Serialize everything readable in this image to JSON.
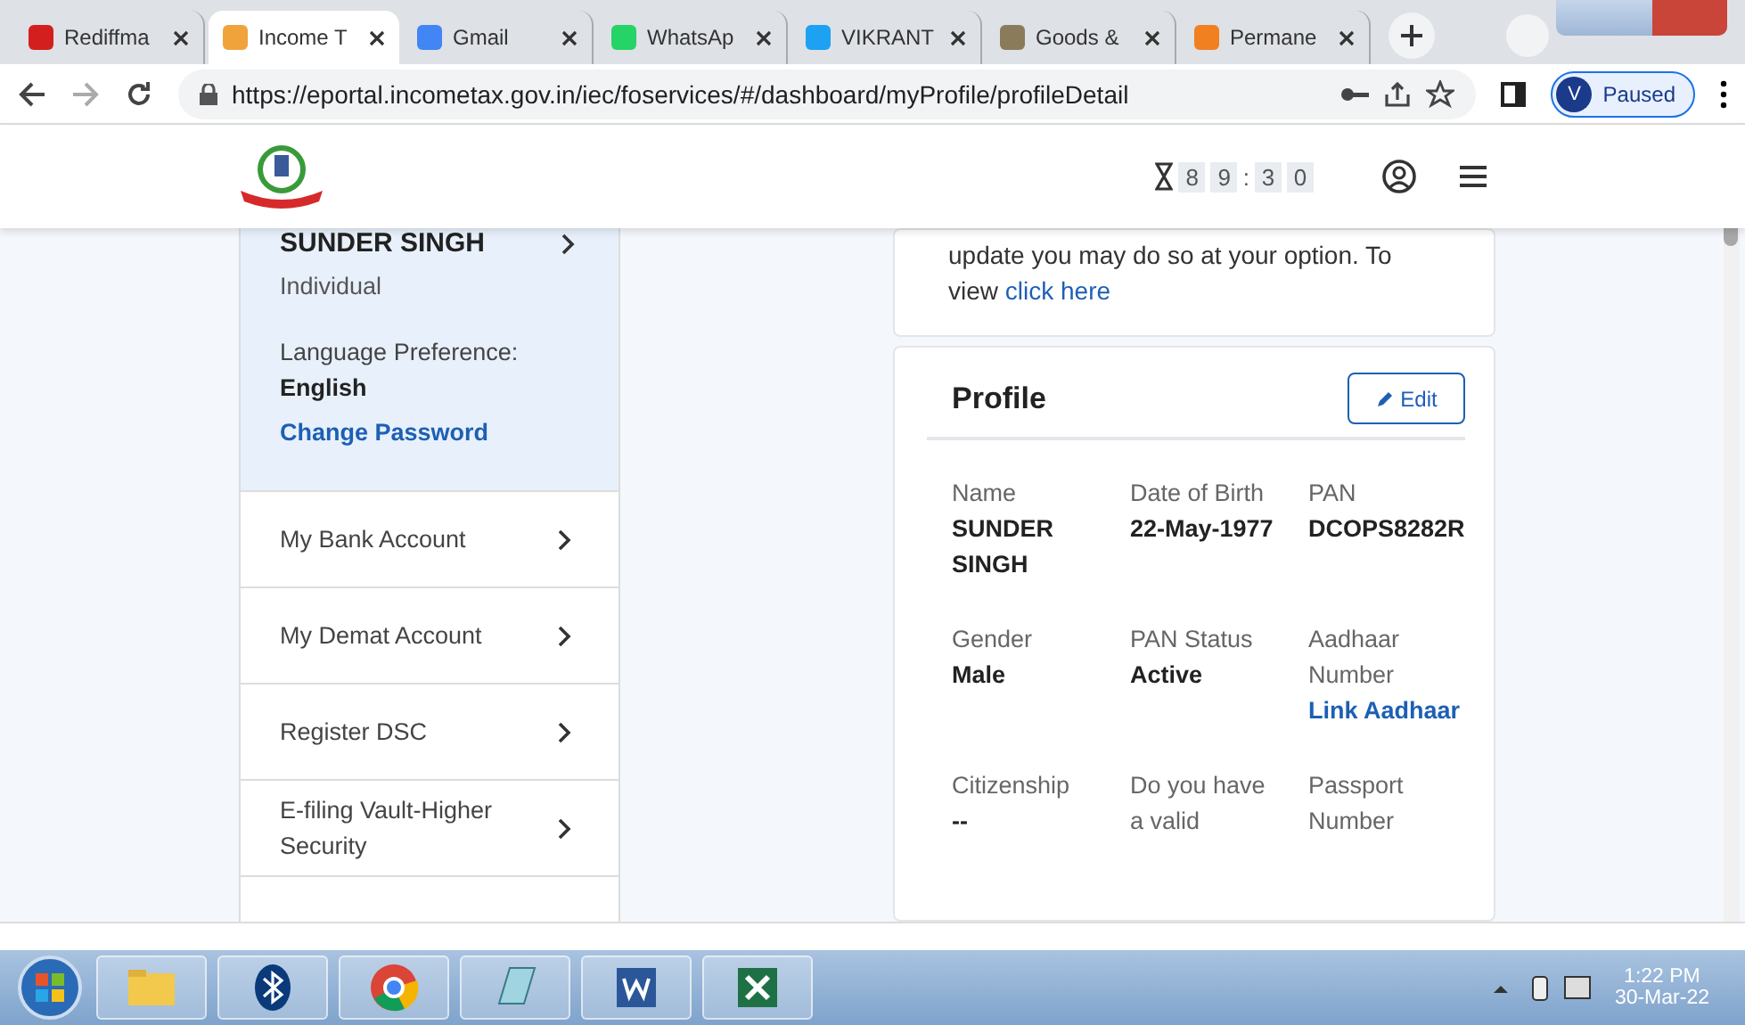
{
  "browser": {
    "tabs": [
      {
        "title": "Rediffma",
        "selected": false
      },
      {
        "title": "Income T",
        "selected": true
      },
      {
        "title": "Gmail",
        "selected": false
      },
      {
        "title": "WhatsAp",
        "selected": false
      },
      {
        "title": "VIKRANT",
        "selected": false
      },
      {
        "title": "Goods &",
        "selected": false
      },
      {
        "title": "Permane",
        "selected": false
      }
    ],
    "url": "https://eportal.incometax.gov.in/iec/foservices/#/dashboard/myProfile/profileDetail",
    "profile_initial": "V",
    "profile_status": "Paused"
  },
  "header": {
    "timer": [
      "8",
      "9",
      ":",
      "3",
      "0"
    ]
  },
  "sidebar": {
    "name": "SUNDER SINGH",
    "type": "Individual",
    "language_label": "Language Preference:",
    "language": "English",
    "change_password": "Change Password",
    "items": [
      {
        "label": "My Bank Account"
      },
      {
        "label": "My Demat Account"
      },
      {
        "label": "Register DSC"
      },
      {
        "label": "E-filing Vault-Higher Security"
      }
    ]
  },
  "notice": {
    "text": "update you may do so at your option. To view",
    "link": "click here"
  },
  "profile": {
    "title": "Profile",
    "edit": "Edit",
    "fields": [
      {
        "label": "Name",
        "value": "SUNDER SINGH"
      },
      {
        "label": "Date of Birth",
        "value": "22-May-1977"
      },
      {
        "label": "PAN",
        "value": "DCOPS8282R"
      },
      {
        "label": "Gender",
        "value": "Male"
      },
      {
        "label": "PAN Status",
        "value": "Active"
      },
      {
        "label": "Aadhaar Number",
        "link": "Link Aadhaar"
      },
      {
        "label": "Citizenship",
        "value": "--"
      },
      {
        "label": "Do you have a valid"
      },
      {
        "label": "Passport Number"
      }
    ]
  },
  "taskbar": {
    "time": "1:22 PM",
    "date": "30-Mar-22"
  }
}
